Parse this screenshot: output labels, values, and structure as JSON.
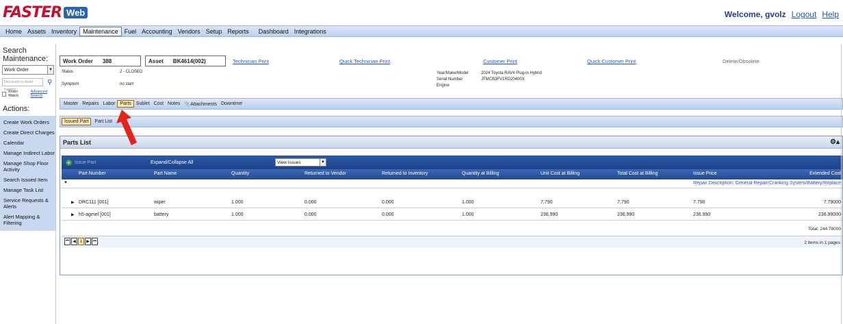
{
  "header": {
    "logo_text": "FASTER",
    "logo_badge": "Web",
    "welcome": "Welcome,",
    "user": "gvolz",
    "logout": "Logout",
    "help": "Help"
  },
  "mainnav": [
    "Home",
    "Assets",
    "Inventory",
    "Maintenance",
    "Fuel",
    "Accounting",
    "Vendors",
    "Setup",
    "Reports",
    "Dashboard",
    "Integrations"
  ],
  "sidebar": {
    "search_title": "Search Maintenance:",
    "search_type": "Work Order",
    "search_placeholder": "Document or Asset Number",
    "exact_match": "Exact Match",
    "advanced_search": "Advanced Search",
    "actions_title": "Actions:",
    "actions": [
      "Create Work Orders",
      "Create Direct Charges",
      "Calendar",
      "Manage Indirect Labor",
      "Manage Shop Floor Activity",
      "Search Issued Item",
      "Manage Task List",
      "Service Requests & Alerts",
      "Alert Mapping & Filtering"
    ]
  },
  "workorder": {
    "wo_label": "Work Order",
    "wo_value": "388",
    "asset_label": "Asset",
    "asset_value": "BK4614(002)",
    "technician_print": "Technician Print",
    "quick_technician_print": "Quick Technician Print",
    "customer_print": "Customer Print",
    "quick_customer_print": "Quick Customer Print",
    "delete_obsolete": "Delete/Obsolete",
    "status_label": "Status",
    "status_value": "2 - CLOSED",
    "symptom_label": "Symptom",
    "symptom_value": "no start",
    "year_make_model_label": "Year/Make/Model",
    "year_make_model_value": "2024 Toyota RAV4 Plug-in Hybrid",
    "serial_label": "Serial Number",
    "serial_value": "JTMCB3FV1RD204003",
    "engine_label": "Engine"
  },
  "subnav": [
    "Master",
    "Repairs",
    "Labor",
    "Parts",
    "Sublet",
    "Cost",
    "Notes",
    "Attachments",
    "Downtime"
  ],
  "subnav2": [
    "Issued Part",
    "Part List"
  ],
  "parts": {
    "panel_title": "Parts List",
    "issue_part": "Issue Part",
    "expand_collapse": "Expand/Collapse All",
    "view_select": "View Issues",
    "columns": [
      "Part Number",
      "Part Name",
      "Quantity",
      "Returned to Vendor",
      "Returned to Inventory",
      "Quantity at Billing",
      "Unit Cost at Billing",
      "Total Cost at Billing",
      "Issue Price",
      "Extended Cost"
    ],
    "group_desc": "Repair Description: General Repair/Cranking System/Battery/Replace",
    "rows": [
      [
        "DRC111 [001]",
        "wiper",
        "1.000",
        "0.000",
        "0.000",
        "1.000",
        "7.790",
        "7.790",
        "7.790",
        "7.79000"
      ],
      [
        "h5-agmel [001]",
        "battery",
        "1.000",
        "0.000",
        "0.000",
        "1.000",
        "236.990",
        "236.990",
        "236.990",
        "236.99000"
      ]
    ],
    "total": "Total: 244.78000",
    "items_info": "2 items in 1 pages",
    "page": "1"
  }
}
